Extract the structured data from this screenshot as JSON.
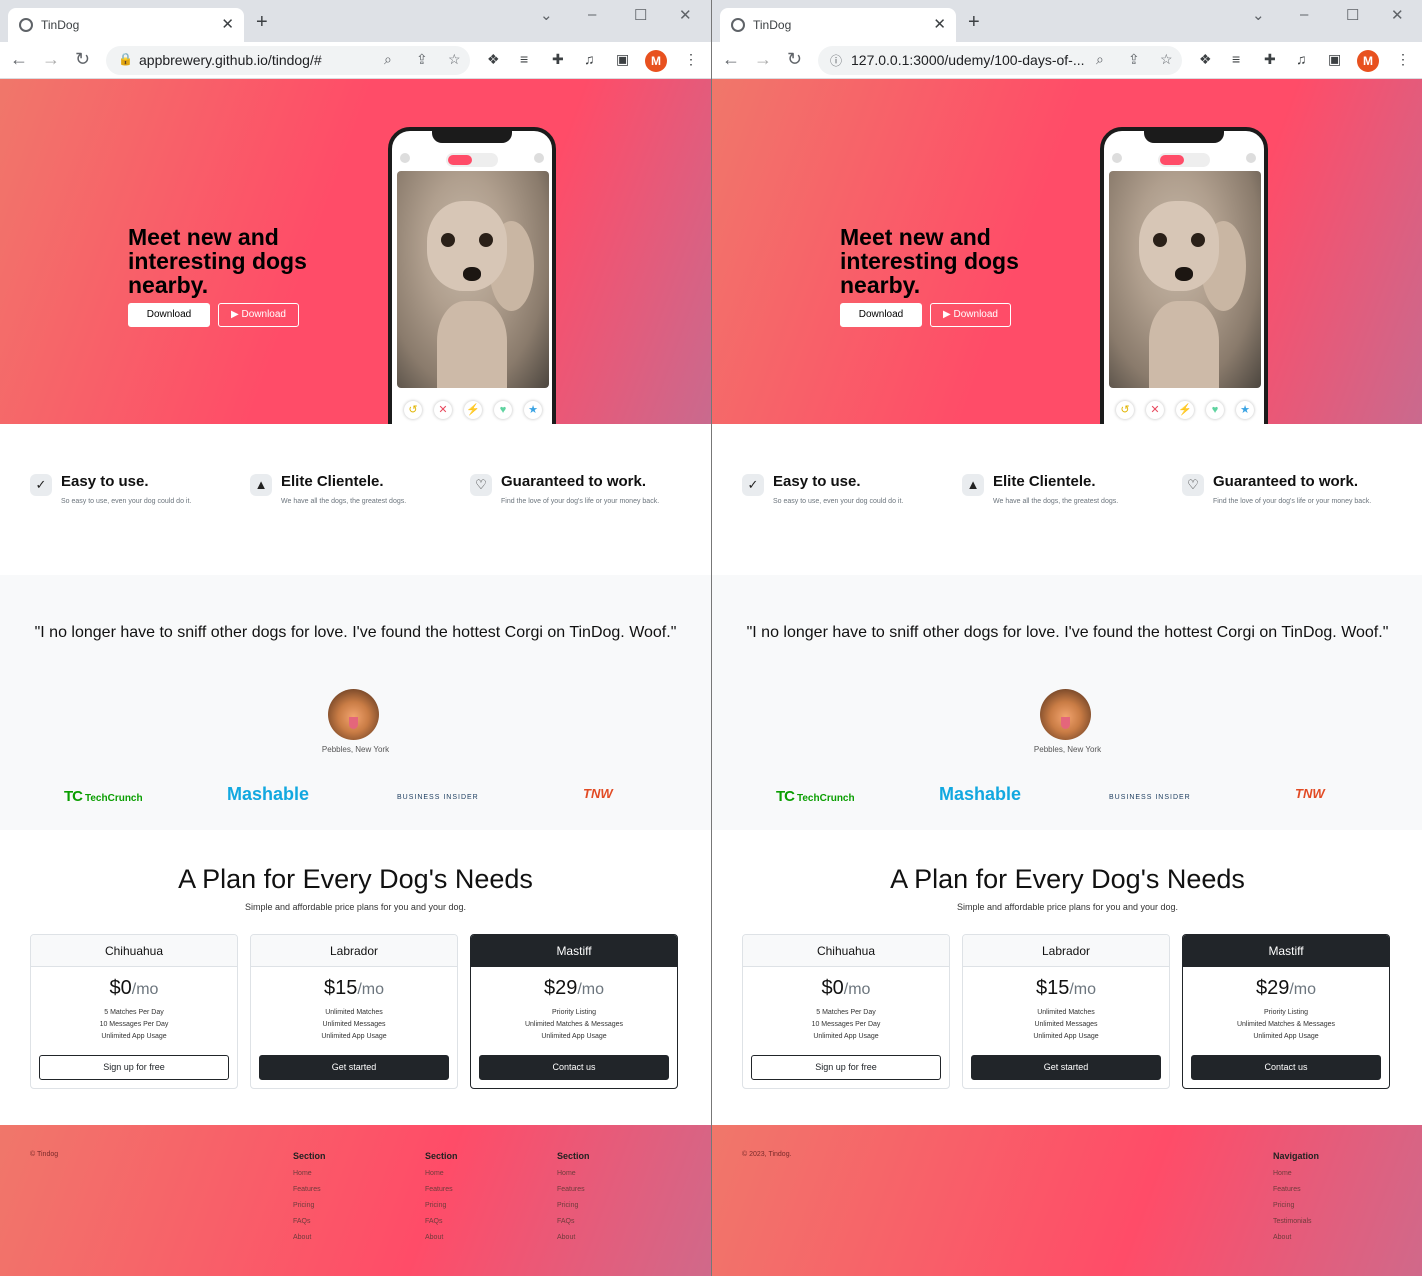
{
  "left": {
    "tab_title": "TinDog",
    "url": "appbrewery.github.io/tindog/#",
    "footer": {
      "copyright": "© Tindog",
      "columns": [
        {
          "heading": "Section",
          "links": [
            "Home",
            "Features",
            "Pricing",
            "FAQs",
            "About"
          ]
        },
        {
          "heading": "Section",
          "links": [
            "Home",
            "Features",
            "Pricing",
            "FAQs",
            "About"
          ]
        },
        {
          "heading": "Section",
          "links": [
            "Home",
            "Features",
            "Pricing",
            "FAQs",
            "About"
          ]
        }
      ]
    }
  },
  "right": {
    "tab_title": "TinDog",
    "url": "127.0.0.1:3000/udemy/100-days-of-...",
    "footer": {
      "copyright": "© 2023, Tindog.",
      "columns": [
        {
          "heading": "Navigation",
          "links": [
            "Home",
            "Features",
            "Pricing",
            "Testimonials",
            "About"
          ]
        }
      ]
    }
  },
  "browser": {
    "profile_initial": "M",
    "icons": [
      "globe-icon",
      "close-icon",
      "new-tab-icon",
      "minimize-icon",
      "maximize-icon",
      "window-close-icon",
      "back-icon",
      "forward-icon",
      "reload-icon",
      "lock-icon",
      "info-icon",
      "zoom-icon",
      "share-icon",
      "star-icon",
      "extension-icon",
      "puzzle-icon",
      "playlist-icon",
      "sidepanel-icon",
      "menu-icon"
    ]
  },
  "hero": {
    "headline": "Meet new and interesting dogs nearby.",
    "download_apple": "Download",
    "download_play": "Download"
  },
  "features": [
    {
      "title": "Easy to use.",
      "desc": "So easy to use, even your dog could do it.",
      "icon": "check-circle-icon"
    },
    {
      "title": "Elite Clientele.",
      "desc": "We have all the dogs, the greatest dogs.",
      "icon": "graduation-cap-icon"
    },
    {
      "title": "Guaranteed to work.",
      "desc": "Find the love of your dog's life or your money back.",
      "icon": "heart-arrow-icon"
    }
  ],
  "testimonial": {
    "quote": "\"I no longer have to sniff other dogs for love. I've found the hottest Corgi on TinDog. Woof.\"",
    "caption": "Pebbles, New York"
  },
  "press": {
    "techcrunch": "TechCrunch",
    "techcrunch_mark": "TC",
    "mashable": "Mashable",
    "business_insider": "BUSINESS INSIDER",
    "tnw": "TNW"
  },
  "pricing": {
    "heading": "A Plan for Every Dog's Needs",
    "subheading": "Simple and affordable price plans for you and your dog.",
    "plans": [
      {
        "name": "Chihuahua",
        "price": "$0",
        "unit": "/mo",
        "features": [
          "5 Matches Per Day",
          "10 Messages Per Day",
          "Unlimited App Usage"
        ],
        "cta": "Sign up for free"
      },
      {
        "name": "Labrador",
        "price": "$15",
        "unit": "/mo",
        "features": [
          "Unlimited Matches",
          "Unlimited Messages",
          "Unlimited App Usage"
        ],
        "cta": "Get started"
      },
      {
        "name": "Mastiff",
        "price": "$29",
        "unit": "/mo",
        "features": [
          "Priority Listing",
          "Unlimited Matches & Messages",
          "Unlimited App Usage"
        ],
        "cta": "Contact us"
      }
    ]
  },
  "colors": {
    "brand": "#ff4c68",
    "dark": "#212529"
  }
}
